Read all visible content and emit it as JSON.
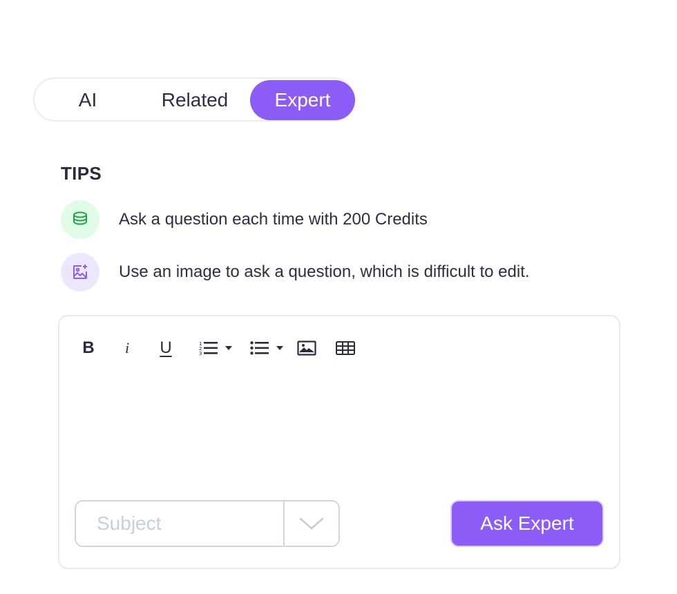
{
  "tabs": [
    {
      "label": "AI",
      "active": false
    },
    {
      "label": "Related",
      "active": false
    },
    {
      "label": "Expert",
      "active": true
    }
  ],
  "tips": {
    "title": "TIPS",
    "items": [
      {
        "icon": "coin-stack-icon",
        "text": "Ask a question each time with 200 Credits"
      },
      {
        "icon": "image-add-icon",
        "text": "Use an image to ask a question, which is difficult to edit."
      }
    ]
  },
  "editor": {
    "toolbar": {
      "bold": "B",
      "italic": "i",
      "underline": "U",
      "icons": [
        "ordered-list-icon",
        "bullet-list-icon",
        "insert-image-icon",
        "insert-table-icon"
      ]
    },
    "subject": {
      "placeholder": "Subject",
      "value": ""
    },
    "submit_label": "Ask Expert"
  },
  "colors": {
    "accent": "#8b5cf6",
    "tip_green_bg": "#e0fbe6",
    "tip_green_icon": "#22a447",
    "tip_purple_bg": "#ede7fd",
    "tip_purple_icon": "#8b5cf6"
  }
}
